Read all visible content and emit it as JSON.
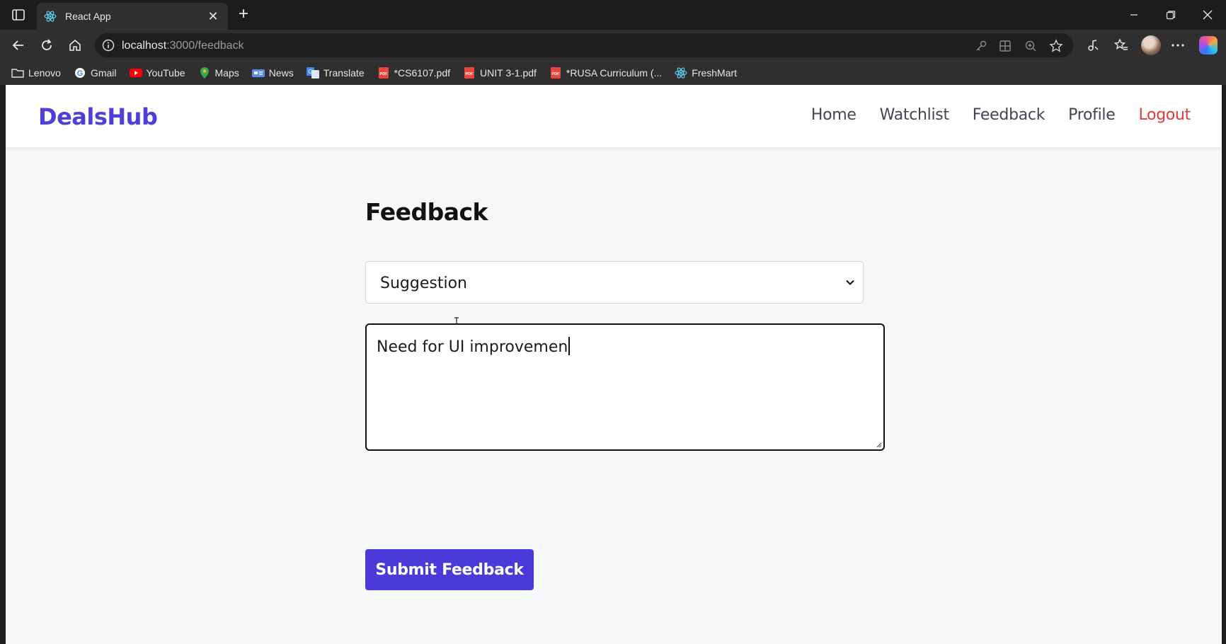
{
  "browser": {
    "tab": {
      "title": "React App"
    },
    "address": {
      "host": "localhost",
      "path": ":3000/feedback"
    },
    "bookmarks": [
      {
        "label": "Lenovo",
        "icon": "folder-icon"
      },
      {
        "label": "Gmail",
        "icon": "google-icon"
      },
      {
        "label": "YouTube",
        "icon": "youtube-icon"
      },
      {
        "label": "Maps",
        "icon": "maps-icon"
      },
      {
        "label": "News",
        "icon": "news-icon"
      },
      {
        "label": "Translate",
        "icon": "translate-icon"
      },
      {
        "label": "*CS6107.pdf",
        "icon": "pdf-icon"
      },
      {
        "label": "UNIT 3-1.pdf",
        "icon": "pdf-icon"
      },
      {
        "label": "*RUSA Curriculum (...",
        "icon": "pdf-icon"
      },
      {
        "label": "FreshMart",
        "icon": "react-icon"
      }
    ]
  },
  "app": {
    "brand": "DealsHub",
    "nav": [
      {
        "label": "Home"
      },
      {
        "label": "Watchlist"
      },
      {
        "label": "Feedback"
      },
      {
        "label": "Profile"
      },
      {
        "label": "Logout"
      }
    ],
    "colors": {
      "brand": "#4f3fd9",
      "button": "#4b3ad9",
      "logout": "#e5383b"
    }
  },
  "feedback": {
    "title": "Feedback",
    "type_select": {
      "value": "Suggestion"
    },
    "message": {
      "value": "Need for UI improvemen"
    },
    "submit_label": "Submit Feedback"
  }
}
